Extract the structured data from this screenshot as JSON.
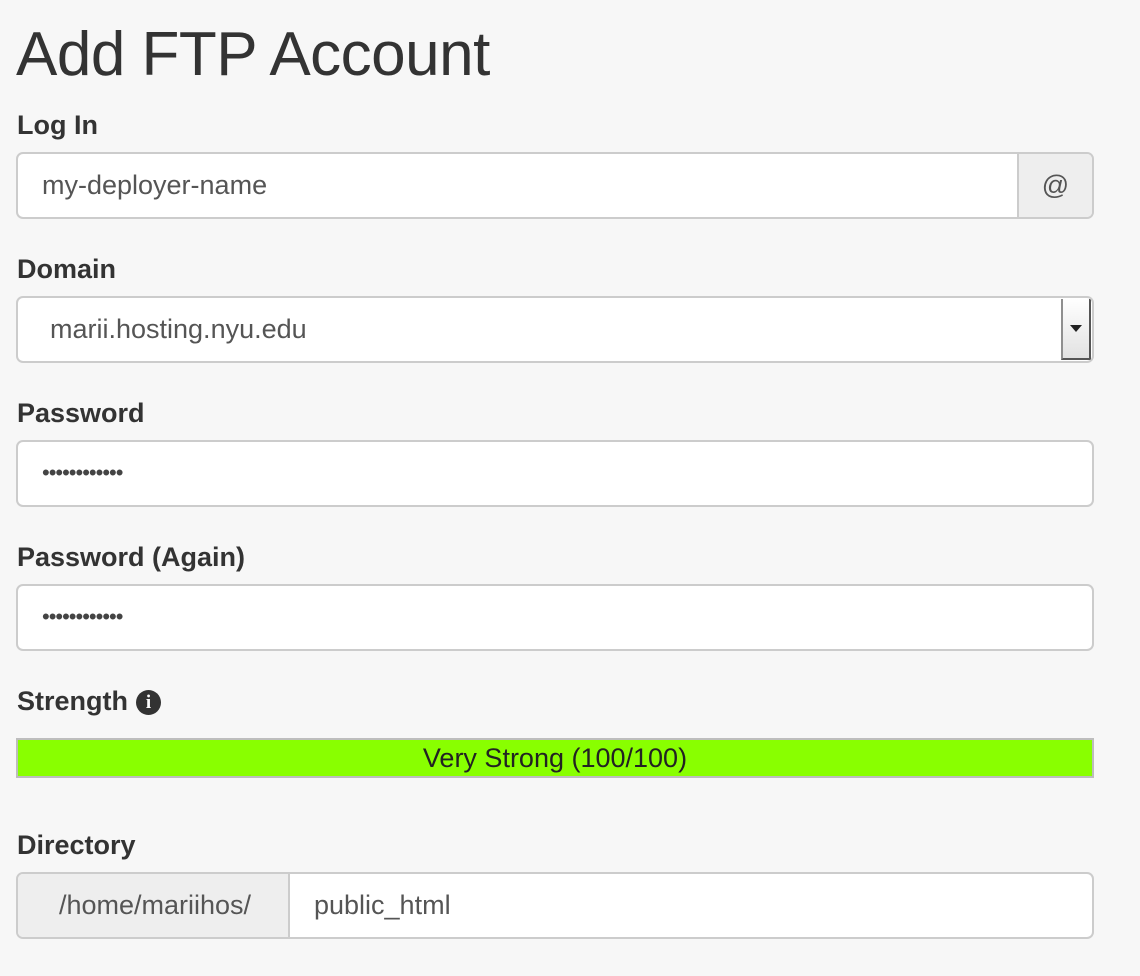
{
  "page": {
    "title": "Add FTP Account"
  },
  "login": {
    "label": "Log In",
    "value": "my-deployer-name",
    "addon": "@"
  },
  "domain": {
    "label": "Domain",
    "selected": "marii.hosting.nyu.edu"
  },
  "password": {
    "label": "Password",
    "masked_value": "••••••••••••"
  },
  "password_again": {
    "label": "Password (Again)",
    "masked_value": "••••••••••••"
  },
  "strength": {
    "label": "Strength",
    "info_icon": "info-circle-icon",
    "text": "Very Strong (100/100)",
    "score": 100,
    "max": 100,
    "color": "#89ff00"
  },
  "directory": {
    "label": "Directory",
    "prefix": "/home/mariihos/",
    "value": "public_html"
  }
}
